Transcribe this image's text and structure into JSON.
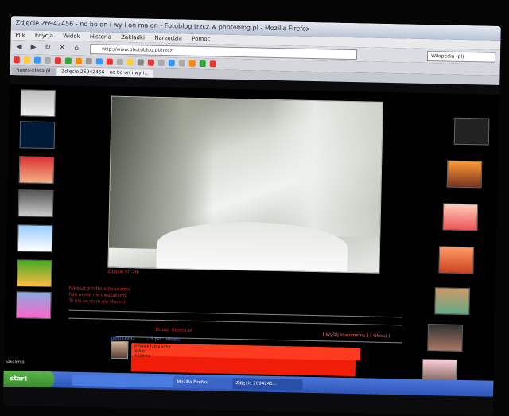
{
  "window": {
    "title": "Zdjęcie 26942456 - no bo on i wy i on ma on - Fotoblog trzcz w photoblog.pl - Mozilla Firefox"
  },
  "menu": [
    "Plik",
    "Edycja",
    "Widok",
    "Historia",
    "Zakładki",
    "Narzędzia",
    "Pomoc"
  ],
  "nav": {
    "url": "http://www.photoblog.pl/trzcz",
    "search": "Wikipedia (pl)"
  },
  "tabs": [
    {
      "label": "nasza-klasa.pl"
    },
    {
      "label": "Zdjęcie 26942456 - no bo on i wy i..."
    }
  ],
  "photo": {
    "caption": "Zdjęcie nr: 26"
  },
  "description": {
    "line1": "Nareszcie tatto a teraz zima",
    "line2": "fajn myśle nie uwazalismy",
    "line3": "To nie sa stare ale stare :)"
  },
  "comments": {
    "add_label": "Dodaj: Gazeta.pl",
    "links": "[ Wyślij znajomemu ] [ Głosuj ]",
    "user": "gizela1992",
    "user_link": "- 5 pkt. tematu",
    "text_line1": "zimowe lubię zimę",
    "text_line2": "ładne",
    "text_line3": "niezame"
  },
  "taskbar": {
    "start": "start",
    "desktop": "Szkolenia",
    "tasks": [
      "",
      "",
      "Mozilla Firefox",
      "Zdjęcie 2694245..."
    ]
  }
}
